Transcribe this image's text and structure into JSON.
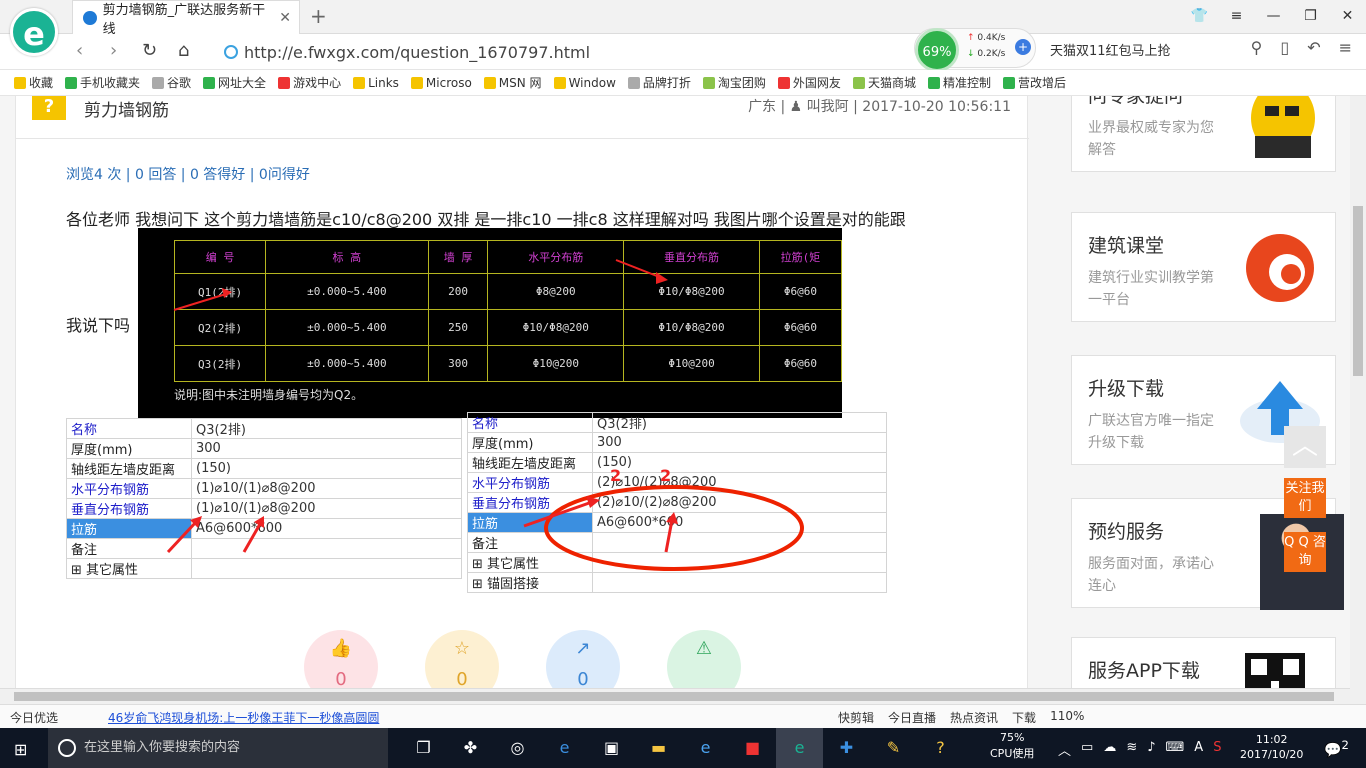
{
  "browser": {
    "logo_letter": "e",
    "tab_title": "剪力墙钢筋_广联达服务新干线",
    "tab_close": "✕",
    "new_tab": "+",
    "url": "http://e.fwxgx.com/question_1670797.html",
    "speed_pct": "69%",
    "speed_up": "0.4K/s",
    "speed_down": "0.2K/s",
    "promo": "天猫双11红包马上抢",
    "nav_back": "‹",
    "nav_forward": "›",
    "nav_refresh": "↻",
    "nav_home": "⌂"
  },
  "favorites": [
    "收藏",
    "手机收藏夹",
    "谷歌",
    "网址大全",
    "游戏中心",
    "Links",
    "Microso",
    "MSN 网",
    "Window",
    "品牌打折",
    "淘宝团购",
    "外国网友",
    "天猫商城",
    "精准控制",
    "营改增后"
  ],
  "question": {
    "title": "剪力墙钢筋",
    "meta": "广东 | ♟ 叫我阿 | 2017-10-20 10:56:11",
    "stats": "浏览4 次 | 0 回答 | 0 答得好 | 0问得好",
    "text": "各位老师 我想问下 这个剪力墙墙筋是c10/c8@200 双排 是一排c10 一排c8 这样理解对吗 我图片哪个设置是对的能跟",
    "say": "我说下吗"
  },
  "cad": {
    "headers": [
      "编 号",
      "标      高",
      "墙 厚",
      "水平分布筋",
      "垂直分布筋",
      "拉筋(矩"
    ],
    "rows": [
      [
        "Q1(2排)",
        "±0.000~5.400",
        "200",
        "Φ8@200",
        "Φ10/Φ8@200",
        "Φ6@60"
      ],
      [
        "Q2(2排)",
        "±0.000~5.400",
        "250",
        "Φ10/Φ8@200",
        "Φ10/Φ8@200",
        "Φ6@60"
      ],
      [
        "Q3(2排)",
        "±0.000~5.400",
        "300",
        "Φ10@200",
        "Φ10@200",
        "Φ6@60"
      ]
    ],
    "note": "说明:图中未注明墙身编号均为Q2。"
  },
  "left_props": [
    {
      "k": "名称",
      "v": "Q3(2排)",
      "blue": true,
      "sel": false
    },
    {
      "k": "厚度(mm)",
      "v": "300",
      "blue": false,
      "sel": false
    },
    {
      "k": "轴线距左墙皮距离",
      "v": "(150)",
      "blue": false,
      "sel": false
    },
    {
      "k": "水平分布钢筋",
      "v": "(1)⌀10/(1)⌀8@200",
      "blue": true,
      "sel": false
    },
    {
      "k": "垂直分布钢筋",
      "v": "(1)⌀10/(1)⌀8@200",
      "blue": true,
      "sel": false
    },
    {
      "k": "拉筋",
      "v": "A6@600*600",
      "blue": false,
      "sel": true
    },
    {
      "k": "备注",
      "v": "",
      "blue": false,
      "sel": false
    },
    {
      "k": "⊞ 其它属性",
      "v": "",
      "blue": false,
      "sel": false
    }
  ],
  "right_props": [
    {
      "k": "名称",
      "v": "Q3(2排)",
      "blue": true,
      "sel": false
    },
    {
      "k": "厚度(mm)",
      "v": "300",
      "blue": false,
      "sel": false
    },
    {
      "k": "轴线距左墙皮距离",
      "v": "(150)",
      "blue": false,
      "sel": false
    },
    {
      "k": "水平分布钢筋",
      "v": "(2)⌀10/(2)⌀8@200",
      "blue": true,
      "sel": false
    },
    {
      "k": "垂直分布钢筋",
      "v": "(2)⌀10/(2)⌀8@200",
      "blue": true,
      "sel": false
    },
    {
      "k": "拉筋",
      "v": "A6@600*600",
      "blue": false,
      "sel": true
    },
    {
      "k": "备注",
      "v": "",
      "blue": false,
      "sel": false
    },
    {
      "k": "⊞ 其它属性",
      "v": "",
      "blue": false,
      "sel": false
    },
    {
      "k": "⊞ 锚固搭接",
      "v": "",
      "blue": false,
      "sel": false
    }
  ],
  "annotation_mark": "2",
  "actions": [
    {
      "icon": "👍",
      "count": "0",
      "color": "#fde3e6",
      "fg": "#e36b80"
    },
    {
      "icon": "☆",
      "count": "0",
      "color": "#fdf0d2",
      "fg": "#e0a52a"
    },
    {
      "icon": "↗",
      "count": "0",
      "color": "#dcebfb",
      "fg": "#3c86d4"
    },
    {
      "icon": "⚠",
      "count": "",
      "color": "#daf4e3",
      "fg": "#2fa55b"
    }
  ],
  "sidebar": [
    {
      "title": "问专家提问",
      "desc": "业界最权威专家为您解答"
    },
    {
      "title": "建筑课堂",
      "desc": "建筑行业实训教学第一平台"
    },
    {
      "title": "升级下载",
      "desc": "广联达官方唯一指定升级下载"
    },
    {
      "title": "预约服务",
      "desc": "服务面对面，承诺心连心"
    },
    {
      "title": "服务APP下载",
      "desc": ""
    }
  ],
  "float_buttons": {
    "follow": "关注我们",
    "qq": "Q Q 咨询",
    "top": "︿"
  },
  "status": {
    "left": "今日优选",
    "news": "46岁俞飞鸿现身机场:上一秒像王菲下一秒像高圆圆",
    "right": [
      "快剪辑",
      "今日直播",
      "热点资讯",
      "下载",
      "110%"
    ]
  },
  "taskbar": {
    "search": "在这里输入你要搜索的内容",
    "cpu_pct": "75%",
    "cpu_label": "CPU使用",
    "ime": "A",
    "time": "11:02",
    "date": "2017/10/20",
    "notif": "2"
  }
}
